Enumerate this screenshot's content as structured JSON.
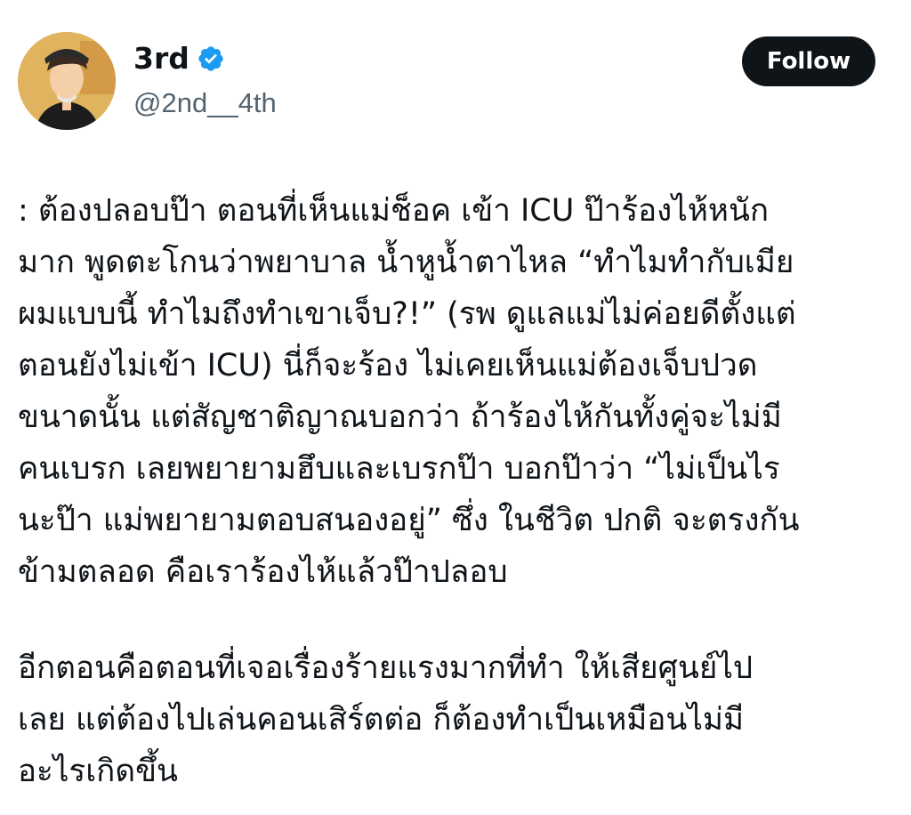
{
  "author": {
    "display_name": "3rd",
    "handle": "@2nd__4th",
    "verified": true,
    "verified_color": "#1d9bf0"
  },
  "actions": {
    "follow_label": "Follow"
  },
  "tweet": {
    "paragraph_1": ": ต้องปลอบป๊า ตอนที่เห็นแม่ช็อค เข้า ICU ป๊าร้องไห้หนัก\nมาก พูดตะโกนว่าพยาบาล น้ำหูน้ำตาไหล “ทำไมทำกับเมีย\nผมแบบนี้ ทำไมถึงทำเขาเจ็บ?!” (รพ ดูแลแม่ไม่ค่อยดีตั้งแต่\nตอนยังไม่เข้า ICU) นี่ก็จะร้อง ไม่เคยเห็นแม่ต้องเจ็บปวด\nขนาดนั้น แต่สัญชาติญาณบอกว่า ถ้าร้องไห้กันทั้งคู่จะไม่มี\nคนเบรก เลยพยายามฮึบและเบรกป๊า บอกป๊าว่า “ไม่เป็นไร\nนะป๊า แม่พยายามตอบสนองอยู่” ซึ่ง ในชีวิต ปกติ จะตรงกัน\nข้ามตลอด คือเราร้องไห้แล้วป๊าปลอบ",
    "paragraph_2": "อีกตอนคือตอนที่เจอเรื่องร้ายแรงมากที่ทำ ให้เสียศูนย์ไป\nเลย แต่ต้องไปเล่นคอนเสิร์ตต่อ ก็ต้องทำเป็นเหมือนไม่มี\nอะไรเกิดขึ้น"
  }
}
